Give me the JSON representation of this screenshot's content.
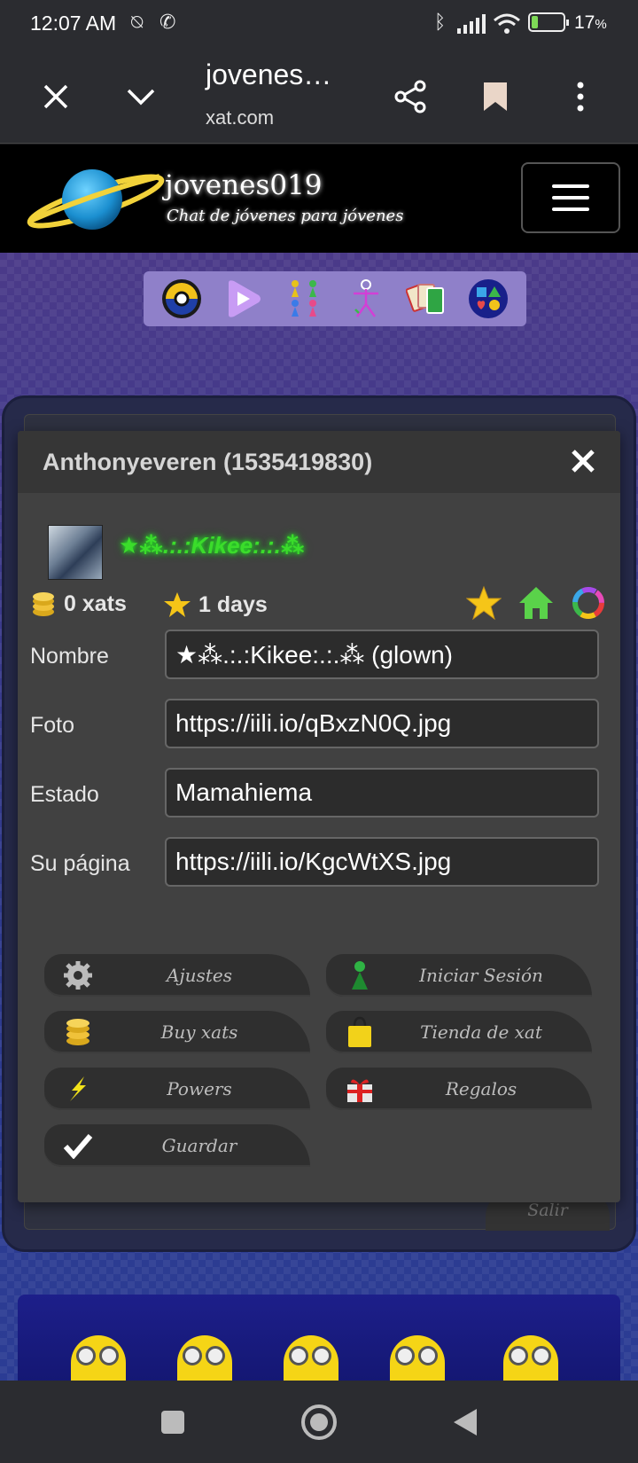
{
  "status_bar": {
    "time": "12:07 AM",
    "battery_pct": "17",
    "battery_suffix": "%"
  },
  "browser": {
    "title": "jovenes…",
    "url": "xat.com"
  },
  "site": {
    "name": "jovenes019",
    "tagline": "Chat de jóvenes para jóvenes"
  },
  "app_strip": [
    "pokeball-icon",
    "video-play-icon",
    "pawns-icon",
    "stick-figure-icon",
    "cards-icon",
    "shapes-icon"
  ],
  "dialog": {
    "title": "Anthonyeveren (1535419830)",
    "display_name": "★⁂.:.:Kikee:.:.⁂",
    "xats": "0 xats",
    "days": "1 days",
    "fields": [
      {
        "label": "Nombre",
        "value": "★⁂.:.:Kikee:.:.⁂ (glown)"
      },
      {
        "label": "Foto",
        "value": "https://iili.io/qBxzN0Q.jpg"
      },
      {
        "label": "Estado",
        "value": "Mamahiema"
      },
      {
        "label": "Su página",
        "value": "https://iili.io/KgcWtXS.jpg"
      }
    ],
    "actions": {
      "ajustes": "Ajustes",
      "iniciar": "Iniciar Sesión",
      "buy": "Buy xats",
      "tienda": "Tienda de xat",
      "powers": "Powers",
      "regalos": "Regalos",
      "guardar": "Guardar"
    }
  },
  "background": {
    "salir": "Salir"
  },
  "colors": {
    "glow_green": "#3bdc2b",
    "dialog_bg": "#414141",
    "page_bg": "#3b3a83"
  }
}
